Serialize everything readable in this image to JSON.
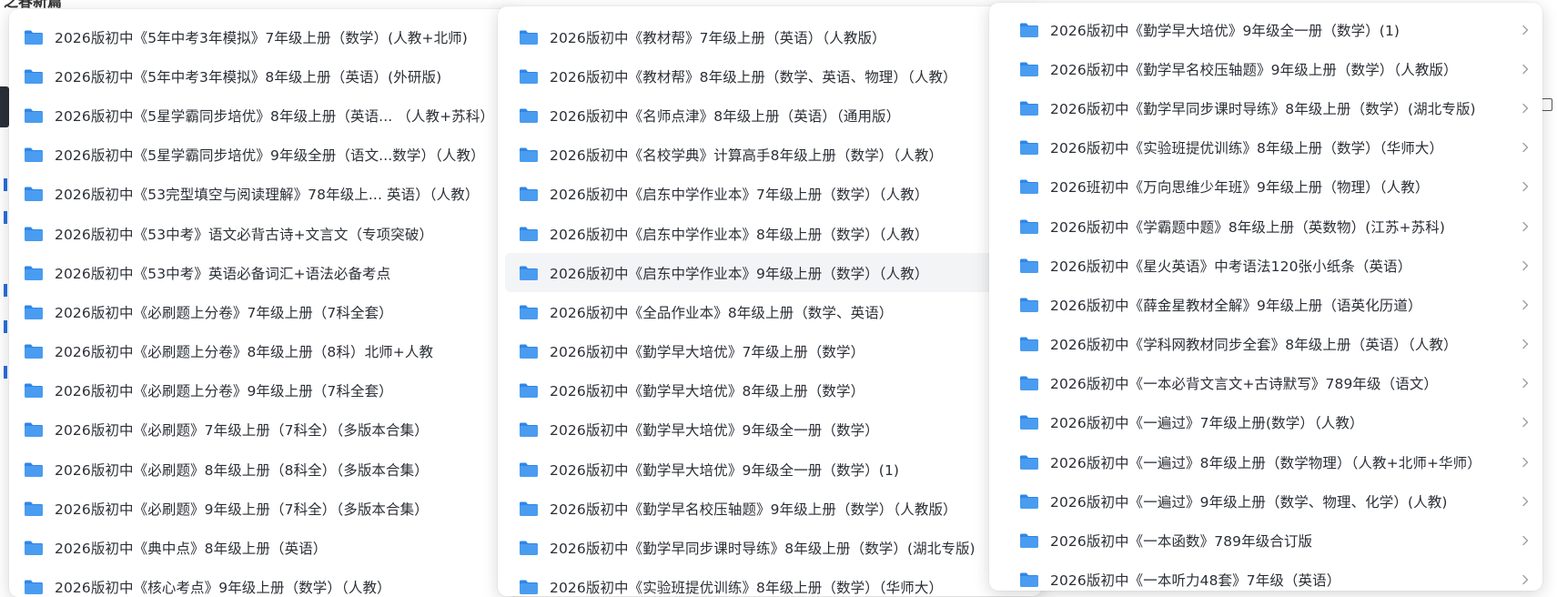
{
  "colors": {
    "folder_fill": "#4a9cf0",
    "folder_tab": "#2f86e8",
    "text": "#2b2f36",
    "chevron": "#9aa0a8",
    "hover_bg": "#f3f4f6"
  },
  "icons": {
    "folder": "folder-icon",
    "chevron": "chevron-right-icon"
  },
  "background": {
    "top_left_fragment": "之春新篇"
  },
  "menu1": {
    "items": [
      {
        "label": "2026版初中《5年中考3年模拟》7年级上册（数学）(人教+北师)"
      },
      {
        "label": "2026版初中《5年中考3年模拟》8年级上册（英语）(外研版)"
      },
      {
        "label": "2026版初中《5星学霸同步培优》8年级上册（英语... （人教+苏科）"
      },
      {
        "label": "2026版初中《5星学霸同步培优》9年级全册（语文...数学）（人教）"
      },
      {
        "label": "2026版初中《53完型填空与阅读理解》78年级上... 英语）（人教）"
      },
      {
        "label": "2026版初中《53中考》语文必背古诗+文言文（专项突破）"
      },
      {
        "label": "2026版初中《53中考》英语必备词汇+语法必备考点"
      },
      {
        "label": "2026版初中《必刷题上分卷》7年级上册（7科全套）"
      },
      {
        "label": "2026版初中《必刷题上分卷》8年级上册（8科）北师+人教"
      },
      {
        "label": "2026版初中《必刷题上分卷》9年级上册（7科全套）"
      },
      {
        "label": "2026版初中《必刷题》7年级上册（7科全）（多版本合集）"
      },
      {
        "label": "2026版初中《必刷题》8年级上册（8科全）（多版本合集）"
      },
      {
        "label": "2026版初中《必刷题》9年级上册（7科全）（多版本合集）"
      },
      {
        "label": "2026版初中《典中点》8年级上册（英语）"
      },
      {
        "label": "2026版初中《核心考点》9年级上册（数学）（人教）"
      }
    ]
  },
  "menu2": {
    "items": [
      {
        "label": "2026版初中《教材帮》7年级上册（英语）（人教版）"
      },
      {
        "label": "2026版初中《教材帮》8年级上册（数学、英语、物理）（人教）"
      },
      {
        "label": "2026版初中《名师点津》8年级上册（英语）（通用版）"
      },
      {
        "label": "2026版初中《名校学典》计算高手8年级上册（数学）（人教）"
      },
      {
        "label": "2026版初中《启东中学作业本》7年级上册（数学）（人教）"
      },
      {
        "label": "2026版初中《启东中学作业本》8年级上册（数学）（人教）"
      },
      {
        "label": "2026版初中《启东中学作业本》9年级上册（数学）（人教）"
      },
      {
        "label": "2026版初中《全品作业本》8年级上册（数学、英语）"
      },
      {
        "label": "2026版初中《勤学早大培优》7年级上册（数学）"
      },
      {
        "label": "2026版初中《勤学早大培优》8年级上册（数学）"
      },
      {
        "label": "2026版初中《勤学早大培优》9年级全一册（数学）"
      },
      {
        "label": "2026版初中《勤学早大培优》9年级全一册（数学）(1)"
      },
      {
        "label": "2026版初中《勤学早名校压轴题》9年级上册（数学）（人教版）"
      },
      {
        "label": "2026版初中《勤学早同步课时导练》8年级上册（数学）(湖北专版)"
      },
      {
        "label": "2026版初中《实验班提优训练》8年级上册（数学）（华师大）"
      }
    ],
    "hover_index": 6
  },
  "menu3": {
    "items": [
      {
        "label": "2026版初中《勤学早大培优》9年级全一册（数学）(1)"
      },
      {
        "label": "2026版初中《勤学早名校压轴题》9年级上册（数学）（人教版）"
      },
      {
        "label": "2026版初中《勤学早同步课时导练》8年级上册（数学）(湖北专版)"
      },
      {
        "label": "2026版初中《实验班提优训练》8年级上册（数学）（华师大）"
      },
      {
        "label": "2026班初中《万向思维少年班》9年级上册（物理）（人教）"
      },
      {
        "label": "2026版初中《学霸题中题》8年级上册（英数物）(江苏+苏科)"
      },
      {
        "label": "2026版初中《星火英语》中考语法120张小纸条（英语）"
      },
      {
        "label": "2026版初中《薛金星教材全解》9年级上册（语英化历道）"
      },
      {
        "label": "2026版初中《学科网教材同步全套》8年级上册（英语）（人教）"
      },
      {
        "label": "2026版初中《一本必背文言文+古诗默写》789年级（语文）"
      },
      {
        "label": "2026版初中《一遍过》7年级上册(数学）（人教）"
      },
      {
        "label": "2026版初中《一遍过》8年级上册（数学物理）（人教+北师+华师）"
      },
      {
        "label": "2026版初中《一遍过》9年级上册（数学、物理、化学）(人教)"
      },
      {
        "label": "2026版初中《一本函数》789年级合订版"
      },
      {
        "label": "2026版初中《一本听力48套》7年级（英语）"
      }
    ]
  }
}
